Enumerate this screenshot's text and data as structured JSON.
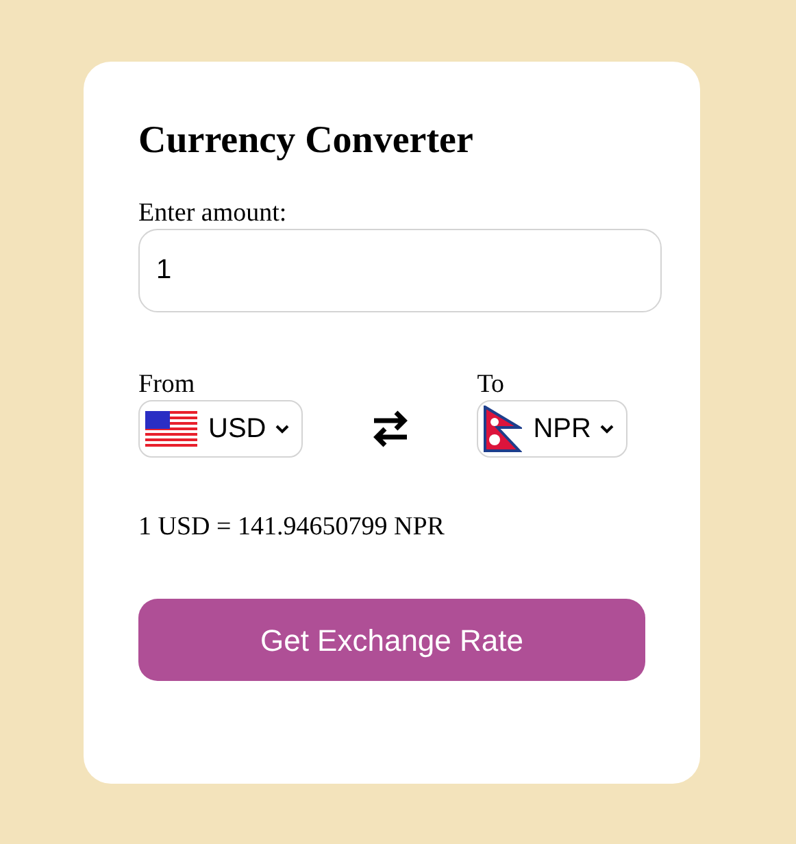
{
  "title": "Currency Converter",
  "amount": {
    "label": "Enter amount:",
    "value": "1"
  },
  "from": {
    "label": "From",
    "currency": "USD"
  },
  "to": {
    "label": "To",
    "currency": "NPR"
  },
  "result": "1 USD = 141.94650799 NPR",
  "button": "Get Exchange Rate"
}
